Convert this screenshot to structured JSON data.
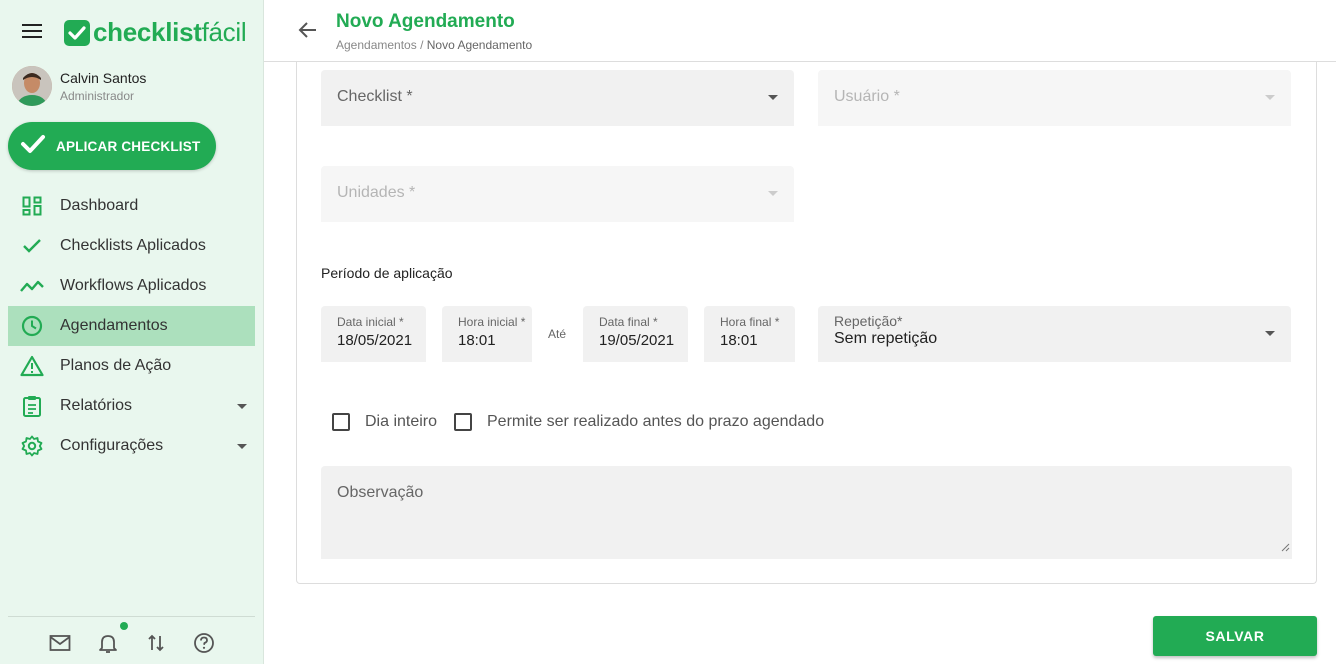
{
  "app": {
    "logo_bold": "checklist",
    "logo_light": "fácil",
    "brand_color": "#22ab54"
  },
  "user": {
    "name": "Calvin Santos",
    "role": "Administrador"
  },
  "apply_button": {
    "label": "APLICAR CHECKLIST"
  },
  "sidebar": {
    "items": [
      {
        "label": "Dashboard",
        "icon": "dashboard-icon"
      },
      {
        "label": "Checklists Aplicados",
        "icon": "check-icon"
      },
      {
        "label": "Workflows Aplicados",
        "icon": "trending-icon"
      },
      {
        "label": "Agendamentos",
        "icon": "clock-icon",
        "active": true
      },
      {
        "label": "Planos de Ação",
        "icon": "warning-icon"
      },
      {
        "label": "Relatórios",
        "icon": "clipboard-icon",
        "expandable": true
      },
      {
        "label": "Configurações",
        "icon": "gear-icon",
        "expandable": true
      }
    ],
    "bottom_icons": [
      "mail-icon",
      "bell-icon",
      "swap-icon",
      "help-icon"
    ]
  },
  "header": {
    "title": "Novo Agendamento",
    "breadcrumb_parent": "Agendamentos",
    "breadcrumb_separator": "/",
    "breadcrumb_current": "Novo Agendamento"
  },
  "form": {
    "checklist_label": "Checklist *",
    "usuario_label": "Usuário *",
    "unidades_label": "Unidades *",
    "periodo_title": "Período de aplicação",
    "data_inicial_label": "Data inicial *",
    "data_inicial_value": "18/05/2021",
    "hora_inicial_label": "Hora inicial *",
    "hora_inicial_value": "18:01",
    "ate_label": "Até",
    "data_final_label": "Data final *",
    "data_final_value": "19/05/2021",
    "hora_final_label": "Hora final *",
    "hora_final_value": "18:01",
    "repeticao_label": "Repetição*",
    "repeticao_value": "Sem repetição",
    "dia_inteiro_label": "Dia inteiro",
    "permite_label": "Permite ser realizado antes do prazo agendado",
    "observacao_label": "Observação"
  },
  "actions": {
    "save_label": "SALVAR"
  }
}
